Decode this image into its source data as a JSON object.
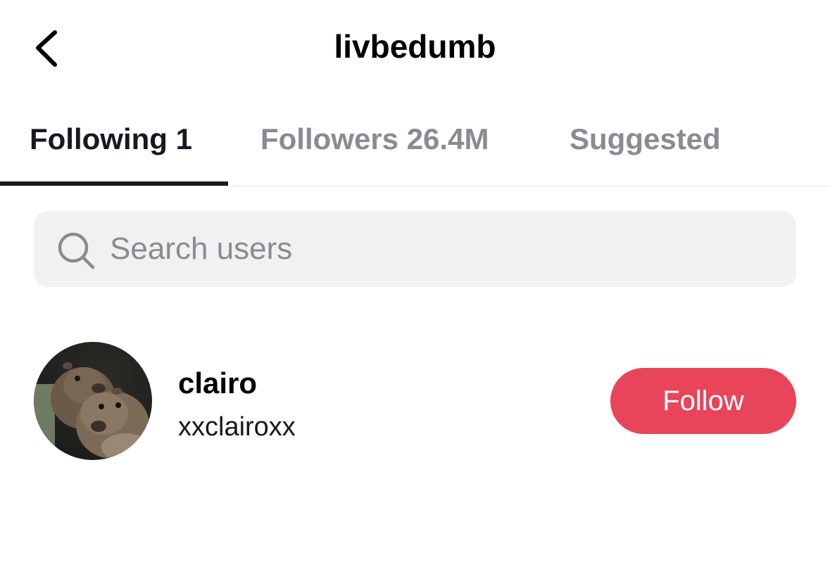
{
  "header": {
    "back_icon": "chevron-left-icon",
    "title": "livbedumb"
  },
  "tabs": [
    {
      "label": "Following 1",
      "active": true
    },
    {
      "label": "Followers 26.4M",
      "active": false
    },
    {
      "label": "Suggested",
      "active": false
    }
  ],
  "search": {
    "icon": "search-icon",
    "placeholder": "Search users",
    "value": ""
  },
  "users": [
    {
      "display_name": "clairo",
      "username": "xxclairoxx",
      "avatar": "avatar-photo-two-rodents",
      "action_label": "Follow"
    }
  ],
  "colors": {
    "follow_button": "#e8445a",
    "text_primary": "#161823",
    "text_secondary": "#8a8b91",
    "search_bg": "#f1f1f2"
  }
}
